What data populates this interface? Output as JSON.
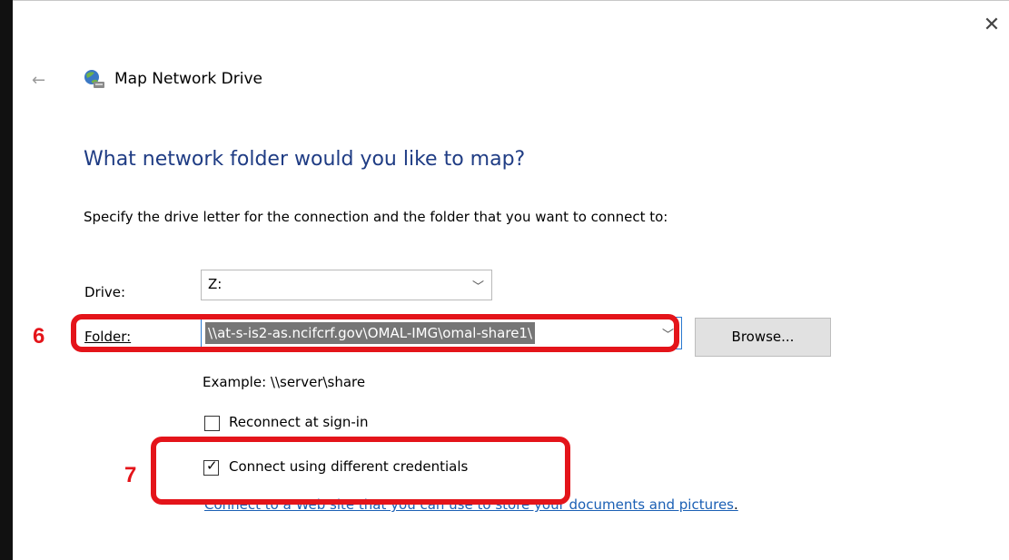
{
  "window": {
    "title": "Map Network Drive",
    "close_icon": "close-icon",
    "back_icon": "back-arrow-icon",
    "app_icon": "network-drive-icon"
  },
  "main": {
    "heading": "What network folder would you like to map?",
    "instruction": "Specify the drive letter for the connection and the folder that you want to connect to:",
    "drive": {
      "label": "Drive:",
      "value": "Z:"
    },
    "folder": {
      "label": "Folder:",
      "value": "\\\\at-s-is2-as.ncifcrf.gov\\OMAL-IMG\\omal-share1\\"
    },
    "browse_label": "Browse...",
    "example": "Example: \\\\server\\share",
    "reconnect": {
      "label": "Reconnect at sign-in",
      "checked": false
    },
    "credentials": {
      "label": "Connect using different credentials",
      "checked": true
    },
    "link": "Connect to a Web site that you can use to store your documents and pictures",
    "link_suffix": "."
  },
  "annotations": {
    "step6": "6",
    "step7": "7",
    "color": "#e4141a"
  }
}
